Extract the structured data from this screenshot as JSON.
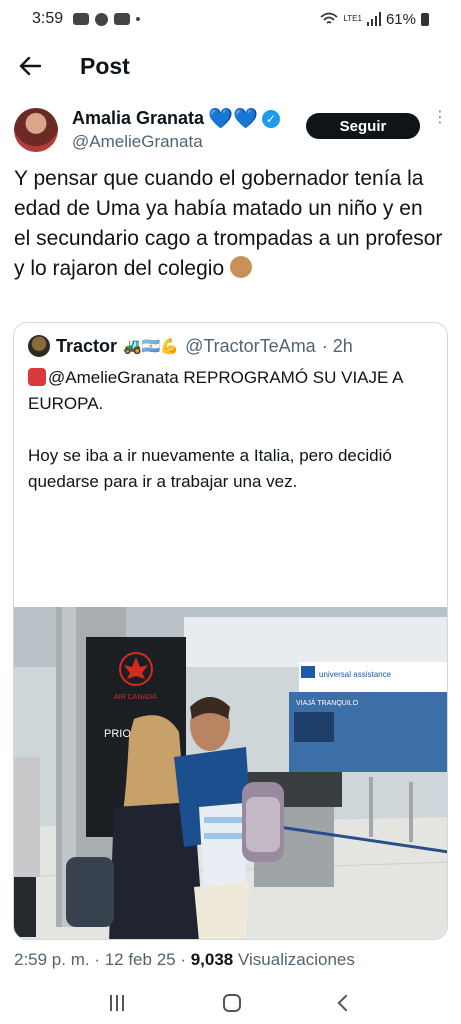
{
  "status_bar": {
    "time": "3:59",
    "battery": "61%",
    "signal_label": "LTE1"
  },
  "header": {
    "title": "Post"
  },
  "tweet": {
    "author_name": "Amalia Granata",
    "author_emojis": "💙💙",
    "author_handle": "@AmelieGranata",
    "follow_label": "Seguir",
    "more_label": "⋮",
    "text": "Y pensar que cuando el gobernador tenía la edad de Uma ya había matado un niño y en el secundario cago a trompadas a un profesor y lo rajaron del colegio",
    "trailing_emoji": "monkey-face",
    "meta_time": "2:59 p. m. · 12 feb 25 · ",
    "meta_views_count": "9,038",
    "meta_views_label": " Visualizaciones"
  },
  "quote": {
    "author_name": "Tractor",
    "author_emojis": "🚜🇦🇷💪",
    "author_handle": "@TractorTeAma",
    "time": "· 2h",
    "line1": "@AmelieGranata REPROGRAMÓ SU VIAJE A EUROPA.",
    "line2": "Hoy se iba a ir nuevamente a Italia, pero decidió quedarse para ir a trabajar una vez.",
    "photo": {
      "sign_brand": "AIR CANADA",
      "sign_text": "PRIOR",
      "booth_brand": "universal assistance",
      "booth_sub": "VIAJÁ TRANQUILO"
    }
  },
  "colors": {
    "accent": "#1d9bf0",
    "text": "#0f1419",
    "secondary": "#536471"
  }
}
